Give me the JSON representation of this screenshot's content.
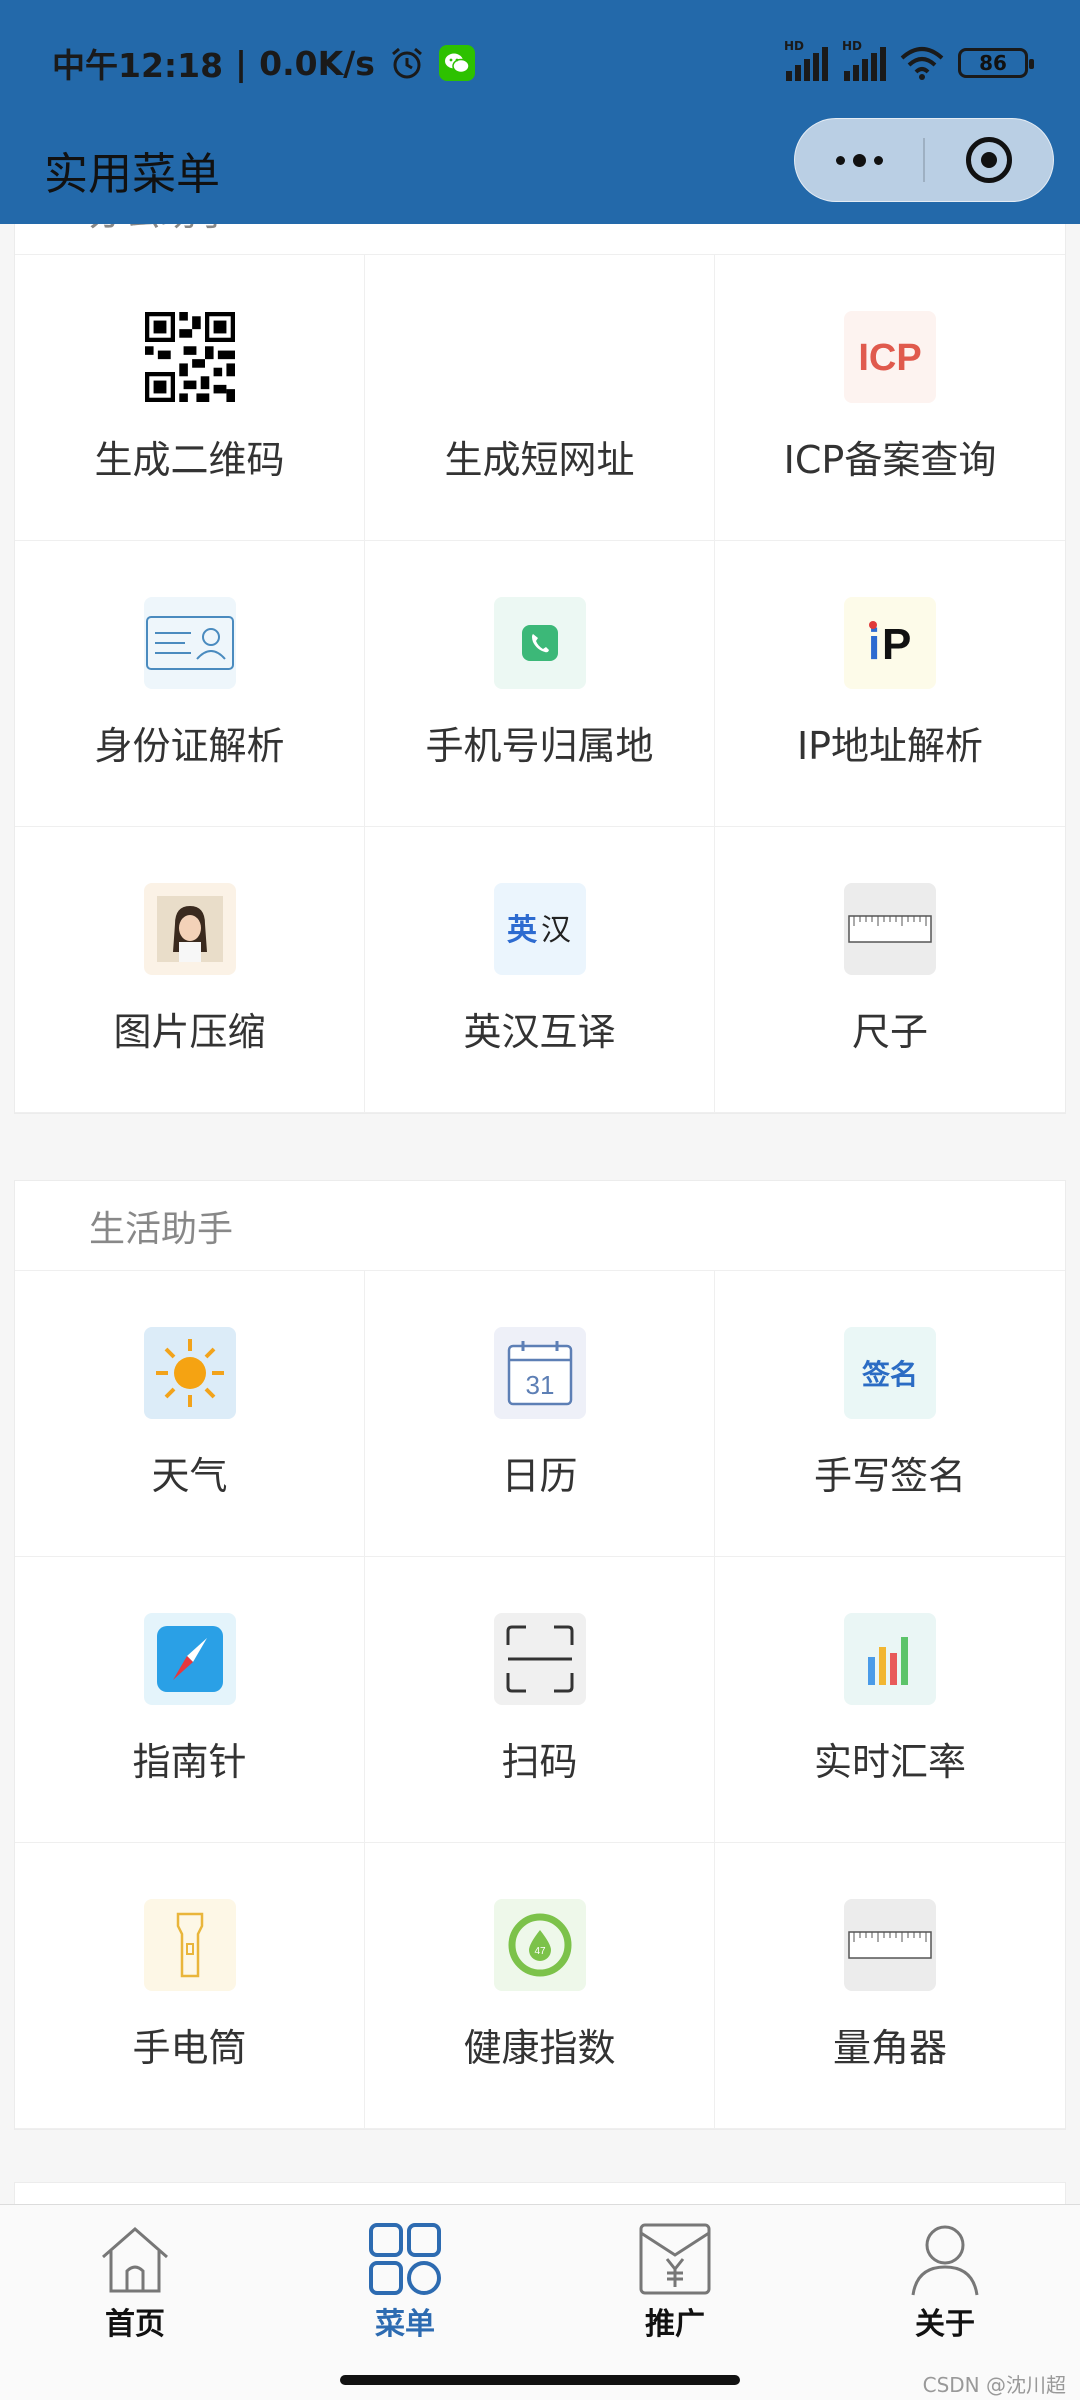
{
  "status_bar": {
    "time": "中午12:18",
    "speed": "0.0K/s",
    "hd1": "HD",
    "hd2": "HD",
    "battery": "86"
  },
  "nav": {
    "title": "实用菜单"
  },
  "sections": [
    {
      "title": "办公助手",
      "items": [
        {
          "label": "生成二维码",
          "icon": "qrcode-icon"
        },
        {
          "label": "生成短网址",
          "icon": "none"
        },
        {
          "label": "ICP备案查询",
          "icon": "icp-icon"
        },
        {
          "label": "身份证解析",
          "icon": "id-card-icon"
        },
        {
          "label": "手机号归属地",
          "icon": "phone-icon"
        },
        {
          "label": "IP地址解析",
          "icon": "ip-icon"
        },
        {
          "label": "图片压缩",
          "icon": "photo-icon"
        },
        {
          "label": "英汉互译",
          "icon": "translate-icon"
        },
        {
          "label": "尺子",
          "icon": "ruler-icon"
        }
      ]
    },
    {
      "title": "生活助手",
      "items": [
        {
          "label": "天气",
          "icon": "sun-icon"
        },
        {
          "label": "日历",
          "icon": "calendar-icon"
        },
        {
          "label": "手写签名",
          "icon": "signature-icon"
        },
        {
          "label": "指南针",
          "icon": "compass-icon"
        },
        {
          "label": "扫码",
          "icon": "scan-icon"
        },
        {
          "label": "实时汇率",
          "icon": "bar-chart-icon"
        },
        {
          "label": "手电筒",
          "icon": "flashlight-icon"
        },
        {
          "label": "健康指数",
          "icon": "health-icon"
        },
        {
          "label": "量角器",
          "icon": "protractor-icon"
        }
      ]
    }
  ],
  "icon_text": {
    "icp": "ICP",
    "ip_i": "i",
    "ip_p": "P",
    "translate_en": "英",
    "translate_cn": "汉",
    "calendar_day": "31",
    "signature": "签名",
    "health": "47"
  },
  "tabbar": [
    {
      "label": "首页",
      "icon": "home-icon",
      "active": false
    },
    {
      "label": "菜单",
      "icon": "menu-grid-icon",
      "active": true
    },
    {
      "label": "推广",
      "icon": "promo-icon",
      "active": false
    },
    {
      "label": "关于",
      "icon": "user-icon",
      "active": false
    }
  ],
  "watermark": "CSDN @沈川超",
  "colors": {
    "nav_bg": "#2369aa",
    "tab_active": "#2d6bb1",
    "wechat": "#2dc100"
  }
}
